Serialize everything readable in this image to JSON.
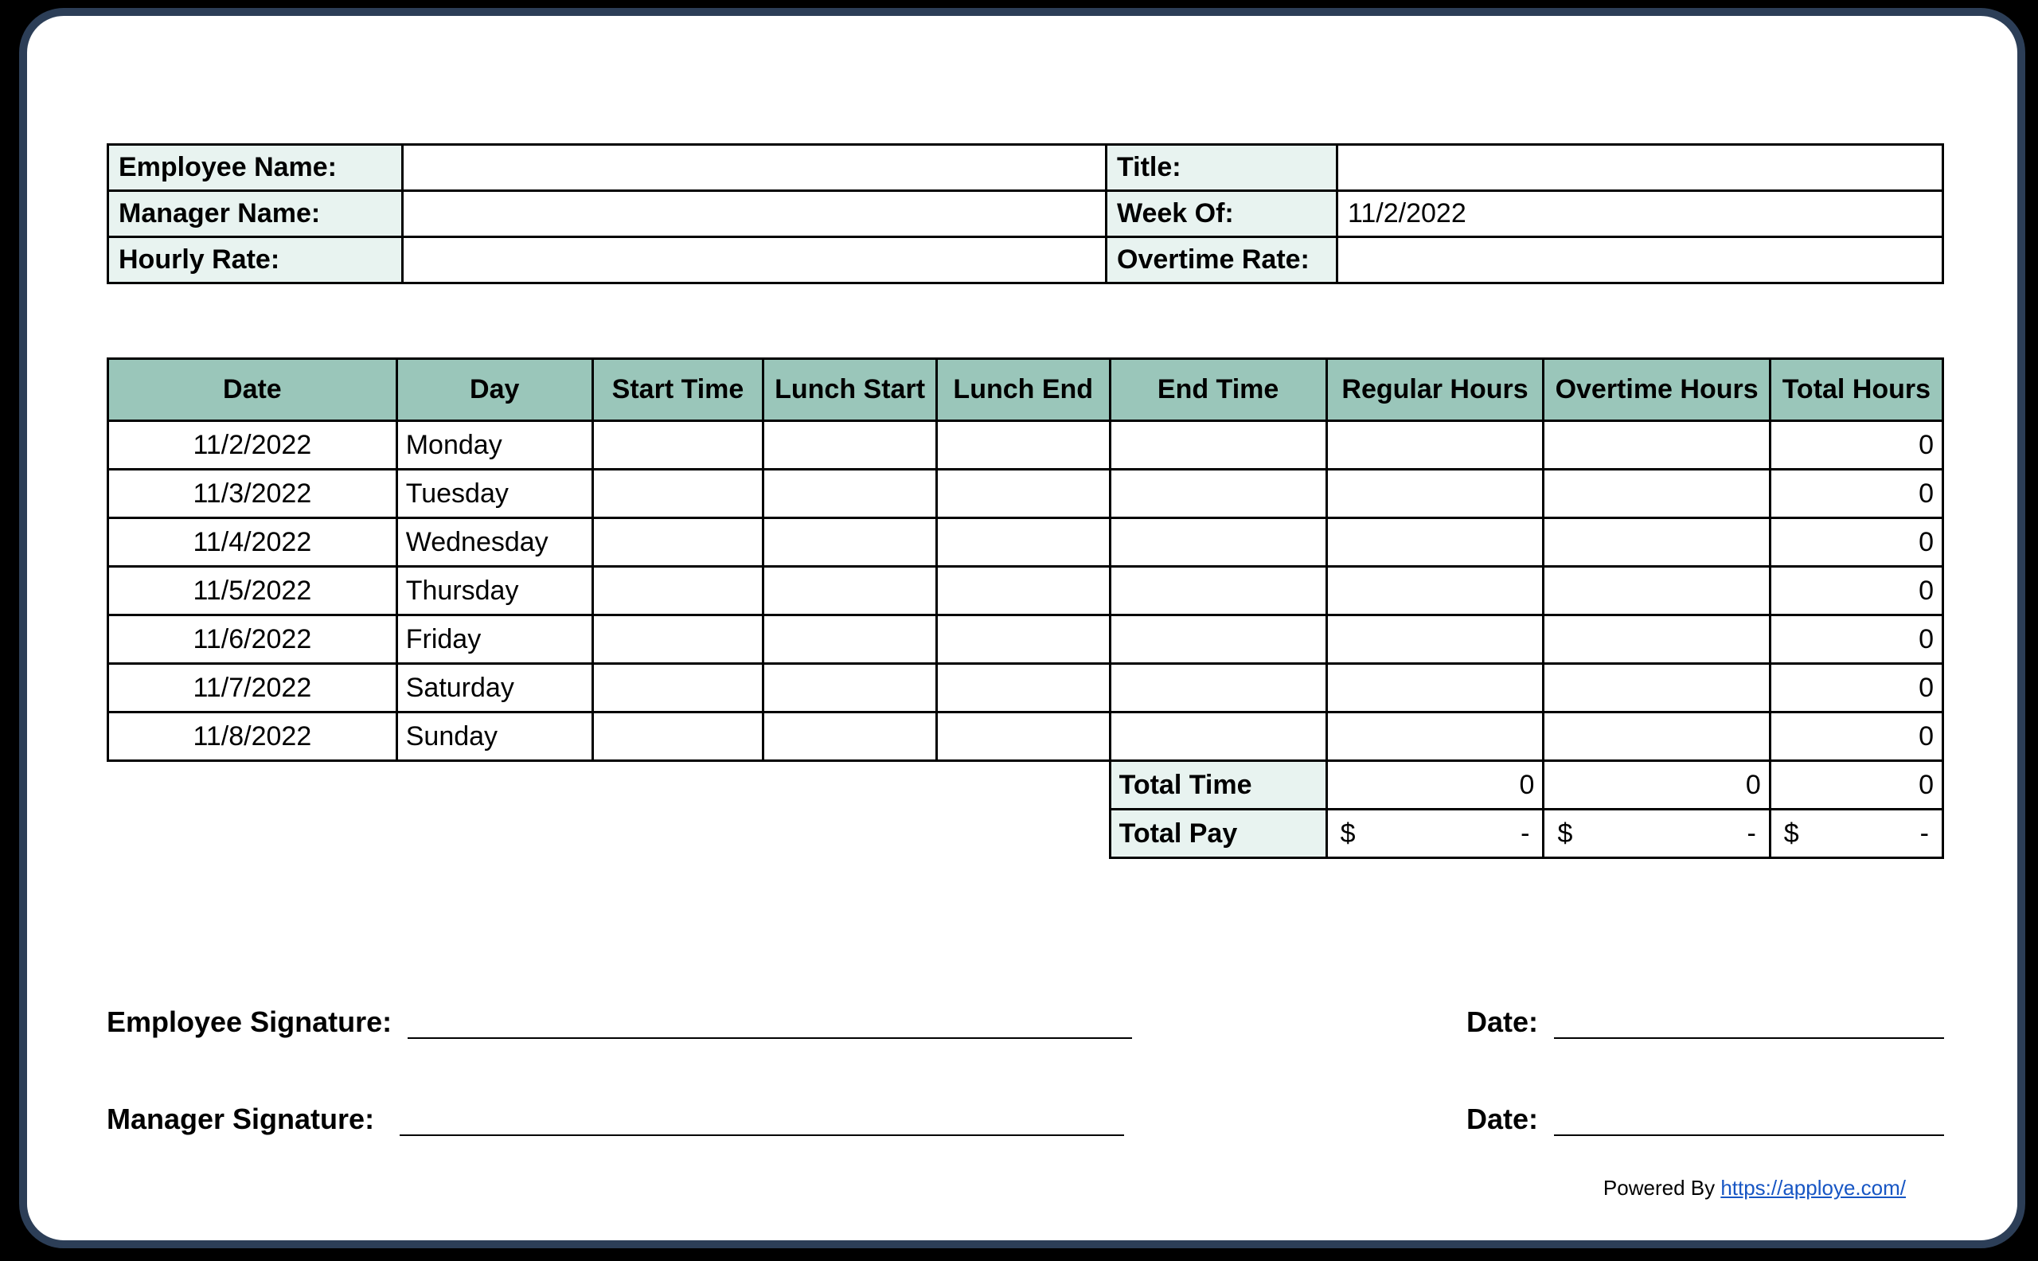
{
  "header": {
    "employee_name_label": "Employee Name:",
    "employee_name_value": "",
    "title_label": "Title:",
    "title_value": "",
    "manager_name_label": "Manager Name:",
    "manager_name_value": "",
    "week_of_label": "Week Of:",
    "week_of_value": "11/2/2022",
    "hourly_rate_label": "Hourly Rate:",
    "hourly_rate_value": "",
    "overtime_rate_label": "Overtime Rate:",
    "overtime_rate_value": ""
  },
  "columns": {
    "date": "Date",
    "day": "Day",
    "start_time": "Start Time",
    "lunch_start": "Lunch Start",
    "lunch_end": "Lunch End",
    "end_time": "End Time",
    "regular_hours": "Regular Hours",
    "overtime_hours": "Overtime Hours",
    "total_hours": "Total Hours"
  },
  "rows": [
    {
      "date": "11/2/2022",
      "day": "Monday",
      "start": "",
      "lunch_start": "",
      "lunch_end": "",
      "end": "",
      "regular": "",
      "overtime": "",
      "total": "0"
    },
    {
      "date": "11/3/2022",
      "day": "Tuesday",
      "start": "",
      "lunch_start": "",
      "lunch_end": "",
      "end": "",
      "regular": "",
      "overtime": "",
      "total": "0"
    },
    {
      "date": "11/4/2022",
      "day": "Wednesday",
      "start": "",
      "lunch_start": "",
      "lunch_end": "",
      "end": "",
      "regular": "",
      "overtime": "",
      "total": "0"
    },
    {
      "date": "11/5/2022",
      "day": "Thursday",
      "start": "",
      "lunch_start": "",
      "lunch_end": "",
      "end": "",
      "regular": "",
      "overtime": "",
      "total": "0"
    },
    {
      "date": "11/6/2022",
      "day": "Friday",
      "start": "",
      "lunch_start": "",
      "lunch_end": "",
      "end": "",
      "regular": "",
      "overtime": "",
      "total": "0"
    },
    {
      "date": "11/7/2022",
      "day": "Saturday",
      "start": "",
      "lunch_start": "",
      "lunch_end": "",
      "end": "",
      "regular": "",
      "overtime": "",
      "total": "0"
    },
    {
      "date": "11/8/2022",
      "day": "Sunday",
      "start": "",
      "lunch_start": "",
      "lunch_end": "",
      "end": "",
      "regular": "",
      "overtime": "",
      "total": "0"
    }
  ],
  "summary": {
    "total_time_label": "Total Time",
    "total_time_regular": "0",
    "total_time_overtime": "0",
    "total_time_total": "0",
    "total_pay_label": "Total Pay",
    "total_pay_regular_sym": "$",
    "total_pay_regular_val": "-",
    "total_pay_overtime_sym": "$",
    "total_pay_overtime_val": "-",
    "total_pay_total_sym": "$",
    "total_pay_total_val": "-"
  },
  "signatures": {
    "employee_label": "Employee Signature:",
    "manager_label": "Manager Signature:",
    "date_label": "Date:"
  },
  "footer": {
    "powered_by": "Powered By ",
    "link_text": "https://apploye.com/"
  },
  "chart_data": {
    "type": "table",
    "title": "Weekly Timesheet",
    "columns": [
      "Date",
      "Day",
      "Start Time",
      "Lunch Start",
      "Lunch End",
      "End Time",
      "Regular Hours",
      "Overtime Hours",
      "Total Hours"
    ],
    "rows": [
      [
        "11/2/2022",
        "Monday",
        "",
        "",
        "",
        "",
        "",
        "",
        0
      ],
      [
        "11/3/2022",
        "Tuesday",
        "",
        "",
        "",
        "",
        "",
        "",
        0
      ],
      [
        "11/4/2022",
        "Wednesday",
        "",
        "",
        "",
        "",
        "",
        "",
        0
      ],
      [
        "11/5/2022",
        "Thursday",
        "",
        "",
        "",
        "",
        "",
        "",
        0
      ],
      [
        "11/6/2022",
        "Friday",
        "",
        "",
        "",
        "",
        "",
        "",
        0
      ],
      [
        "11/7/2022",
        "Saturday",
        "",
        "",
        "",
        "",
        "",
        "",
        0
      ],
      [
        "11/8/2022",
        "Sunday",
        "",
        "",
        "",
        "",
        "",
        "",
        0
      ]
    ],
    "totals": {
      "regular": 0,
      "overtime": 0,
      "total": 0
    },
    "pay": {
      "regular": null,
      "overtime": null,
      "total": null,
      "currency": "$"
    }
  }
}
